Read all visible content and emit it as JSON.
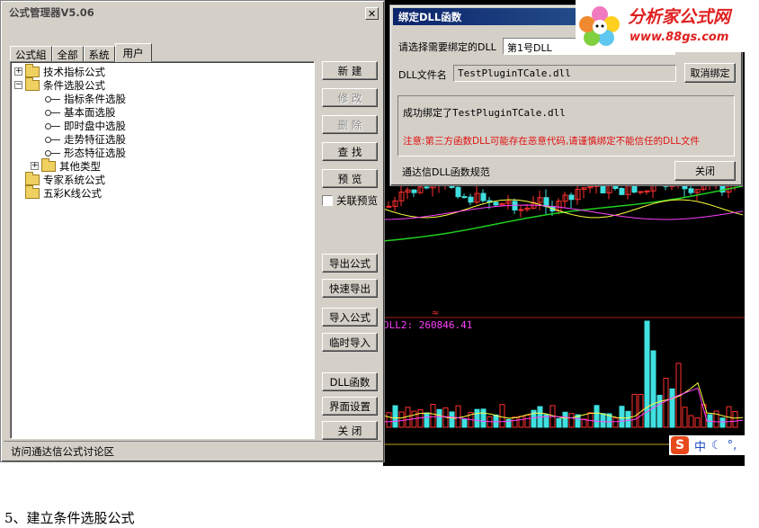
{
  "main_window": {
    "title": "公式管理器V5.06",
    "close_glyph": "✕",
    "tabs": [
      "公式組",
      "全部",
      "系统",
      "用户"
    ],
    "tree": [
      {
        "label": "技术指标公式",
        "kind": "folder",
        "expander": "+"
      },
      {
        "label": "条件选股公式",
        "kind": "folder",
        "expander": "−"
      },
      {
        "label": "指标条件选股",
        "kind": "key"
      },
      {
        "label": "基本面选股",
        "kind": "key"
      },
      {
        "label": "即时盘中选股",
        "kind": "key"
      },
      {
        "label": "走势特征选股",
        "kind": "key"
      },
      {
        "label": "形态特征选股",
        "kind": "key"
      },
      {
        "label": "其他类型",
        "kind": "folder",
        "expander": "+"
      },
      {
        "label": "专家系统公式",
        "kind": "folder"
      },
      {
        "label": "五彩K线公式",
        "kind": "folder"
      }
    ],
    "buttons": {
      "new": "新 建",
      "edit": "修 改",
      "delete": "删 除",
      "find": "查 找",
      "preview": "预 览",
      "export": "导出公式",
      "quick_export": "快速导出",
      "import": "导入公式",
      "temp_import": "临时导入",
      "dll": "DLL函数",
      "ui_settings": "界面设置",
      "close": "关 闭"
    },
    "link_preview": "关联预览",
    "status": "访问通达信公式讨论区"
  },
  "dll_dialog": {
    "title": "绑定DLL函数",
    "close_glyph": "✕",
    "select_label": "请选择需要绑定的DLL",
    "select_value": "第1号DLL",
    "filename_label": "DLL文件名",
    "filename_value": "TestPluginTCale.dll",
    "unbind_button": "取消绑定",
    "bound_message": "成功绑定了TestPluginTCale.dll",
    "warning_message": "注意:第三方函数DLL可能存在恶意代码,请谨慎绑定不能信任的DLL文件",
    "spec_label": "通达信DLL函数规范",
    "close_button": "关闭"
  },
  "chart": {
    "volume_label": "DLL2: 260846.41",
    "colors": {
      "up": "#ff3030",
      "down": "#40e0e0",
      "ma_yellow": "#ffff40",
      "ma_magenta": "#ff40ff",
      "ma_green": "#20d020",
      "line_white": "#ffffff"
    }
  },
  "watermark": {
    "title": "分析家公式网",
    "url": "www.88gs.com"
  },
  "ime": {
    "logo": "S",
    "mode": "中"
  },
  "caption": "5、建立条件选股公式"
}
